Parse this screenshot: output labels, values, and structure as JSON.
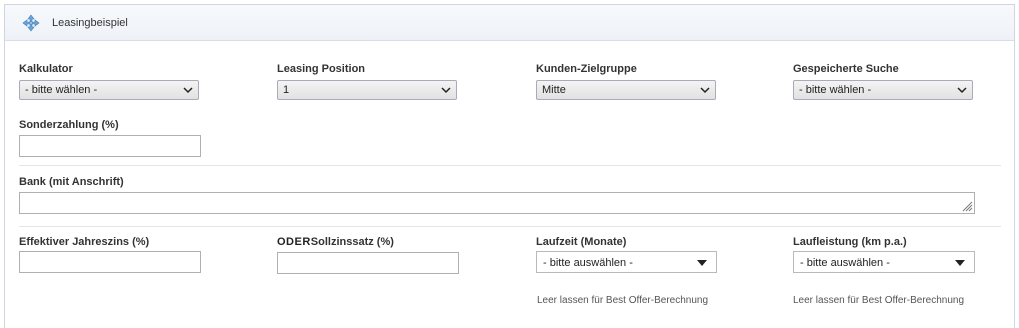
{
  "panel": {
    "title": "Leasingbeispiel",
    "icon": "move-arrows-icon"
  },
  "fields": {
    "kalkulator": {
      "label": "Kalkulator",
      "value": "- bitte wählen -"
    },
    "leasing_position": {
      "label": "Leasing Position",
      "value": "1"
    },
    "kunden_zielgruppe": {
      "label": "Kunden-Zielgruppe",
      "value": "Mitte"
    },
    "gespeicherte_suche": {
      "label": "Gespeicherte Suche",
      "value": "- bitte wählen -"
    },
    "sonderzahlung": {
      "label": "Sonderzahlung (%)",
      "value": ""
    },
    "bank": {
      "label": "Bank (mit Anschrift)",
      "value": ""
    },
    "effektiver_jahreszins": {
      "label": "Effektiver Jahreszins (%)",
      "value": ""
    },
    "sollzinssatz": {
      "prefix": "ODER",
      "label": "Sollzinssatz (%)",
      "value": ""
    },
    "laufzeit": {
      "label": "Laufzeit (Monate)",
      "value": "- bitte auswählen -",
      "hint": "Leer lassen für Best Offer-Berechnung"
    },
    "laufleistung": {
      "label": "Laufleistung (km p.a.)",
      "value": "- bitte auswählen -",
      "hint": "Leer lassen für Best Offer-Berechnung"
    }
  }
}
